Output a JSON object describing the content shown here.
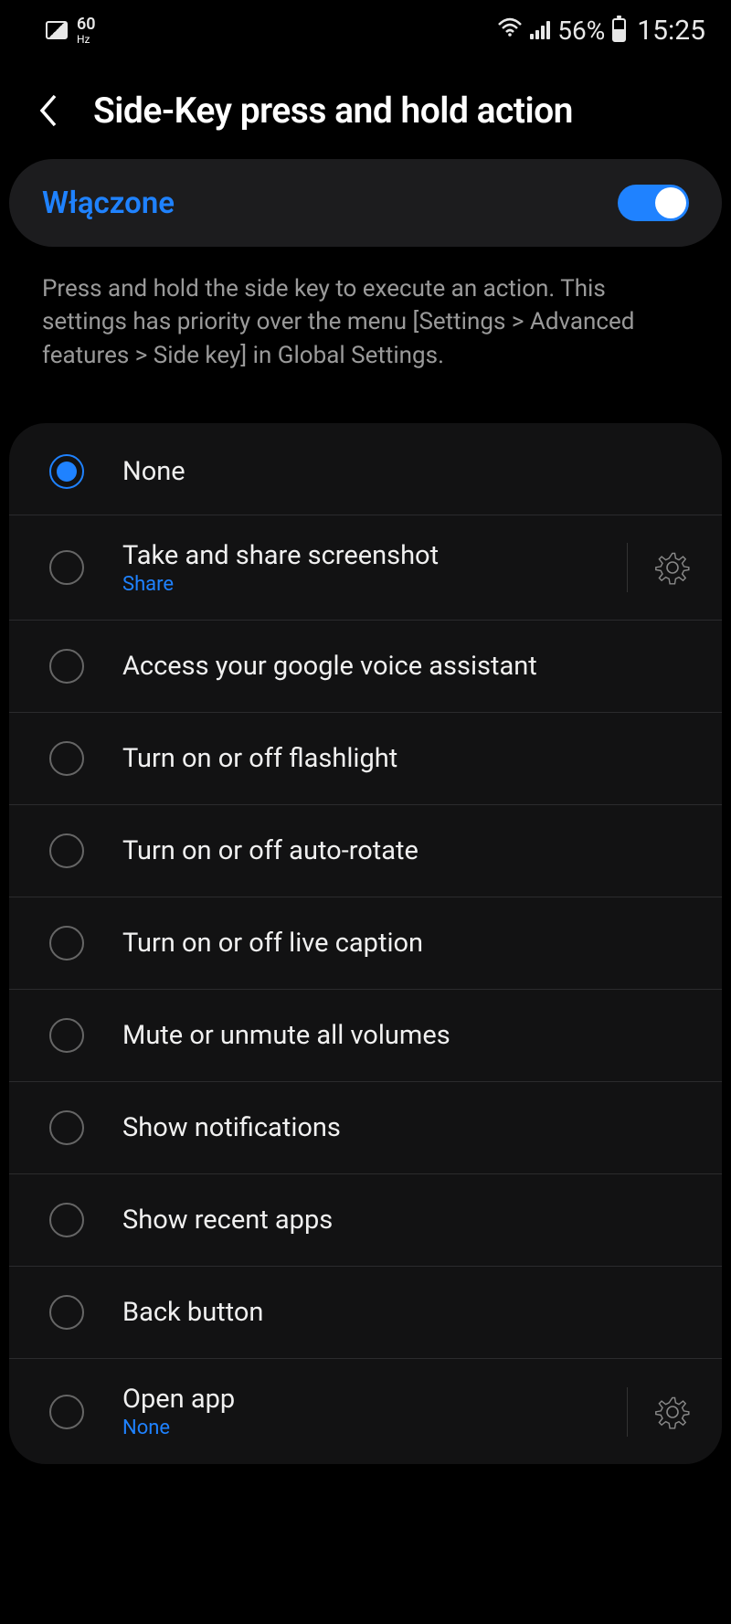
{
  "status": {
    "hz": "60",
    "hz_unit": "Hz",
    "battery_pct": "56%",
    "time": "15:25"
  },
  "header": {
    "title": "Side-Key press and hold action"
  },
  "toggle": {
    "label": "Włączone",
    "enabled": true
  },
  "description": "Press and hold the side key to execute an action. This settings has priority over the menu [Settings > Advanced features > Side key] in Global Settings.",
  "options": [
    {
      "label": "None",
      "selected": true
    },
    {
      "label": "Take and share screenshot",
      "sub": "Share",
      "gear": true
    },
    {
      "label": "Access your google voice assistant"
    },
    {
      "label": "Turn on or off flashlight"
    },
    {
      "label": "Turn on or off auto-rotate"
    },
    {
      "label": "Turn on or off live caption"
    },
    {
      "label": "Mute or unmute all volumes"
    },
    {
      "label": "Show notifications"
    },
    {
      "label": "Show recent apps"
    },
    {
      "label": "Back button"
    },
    {
      "label": "Open app",
      "sub": "None",
      "gear": true
    }
  ]
}
